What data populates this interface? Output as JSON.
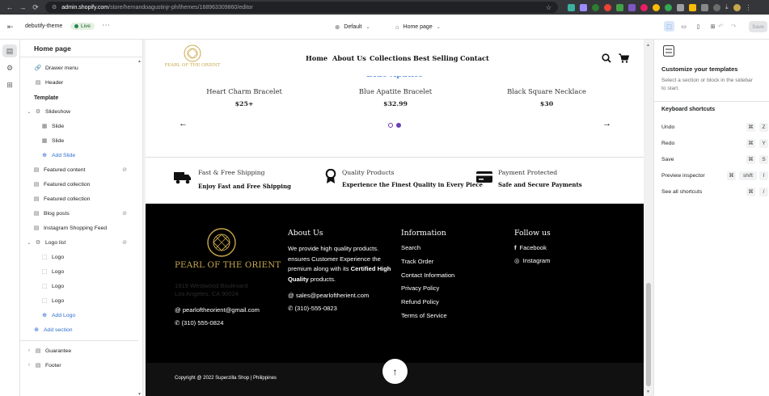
{
  "browser": {
    "url_host": "admin.shopify.com",
    "url_path": "/store/hernandoagustinjr-ph/themes/168963309860/editor"
  },
  "topbar": {
    "theme_name": "debutify-theme",
    "live_badge": "Live",
    "template_select": "Default",
    "page_select": "Home page",
    "save_label": "Save"
  },
  "sidebar": {
    "title": "Home page",
    "drawer_menu": "Drawer menu",
    "header": "Header",
    "template_heading": "Template",
    "slideshow": "Slideshow",
    "slide_1": "Slide",
    "slide_2": "Slide",
    "add_slide": "Add Slide",
    "featured_content": "Featured content",
    "featured_collection_1": "Featured collection",
    "featured_collection_2": "Featured collection",
    "blog_posts": "Blog posts",
    "instagram_feed": "Instagram Shopping Feed",
    "logo_list": "Logo list",
    "logo_1": "Logo",
    "logo_2": "Logo",
    "logo_3": "Logo",
    "logo_4": "Logo",
    "add_logo": "Add Logo",
    "add_section": "Add section",
    "guarantee": "Guarantee",
    "footer": "Footer"
  },
  "store": {
    "logo_text": "PEARL OF THE ORIENT",
    "nav": [
      "Home",
      "About Us",
      "Collections",
      "Best Selling",
      "Contact"
    ],
    "banner_overlay": "Blue Apatite",
    "products": [
      {
        "name": "Heart Charm Bracelet",
        "price": "$25+"
      },
      {
        "name": "Blue Apatite Bracelet",
        "price": "$32.99"
      },
      {
        "name": "Black Square Necklace",
        "price": "$30"
      }
    ],
    "features": [
      {
        "title": "Fast & Free Shipping",
        "sub": "Enjoy Fast and Free Shipping"
      },
      {
        "title": "Quality Products",
        "sub": "Experience the Finest Quality in Every Piece"
      },
      {
        "title": "Payment Protected",
        "sub": "Safe and Secure Payments"
      }
    ],
    "footer": {
      "logo_text": "PEARL OF THE ORIENT",
      "address_1": "1819 Westwood Boulevard",
      "address_2": "Los Angeles, CA 90024",
      "email": "pearloftheorient@gmail.com",
      "phone": "(310) 555-0824",
      "about_heading": "About Us",
      "about_text_1": "We provide high quality products. ensures Customer Experience the premium along with its ",
      "about_text_bold": "Certified High Quality",
      "about_text_2": " products.",
      "about_email": "sales@pearloftherient.com",
      "about_phone": "(310)-555-0823",
      "info_heading": "Information",
      "info_links": [
        "Search",
        "Track Order",
        "Contact Information",
        "Privacy Policy",
        "Refund Policy",
        "Terms of Service"
      ],
      "follow_heading": "Follow us",
      "facebook": "Facebook",
      "instagram": "Instagram",
      "copyright": "Copyright @ 2022 Superzilla Shop | Philippines"
    }
  },
  "rpanel": {
    "heading": "Customize your templates",
    "subtext": "Select a section or block in the sidebar to start.",
    "shortcuts_heading": "Keyboard shortcuts",
    "shortcuts": [
      {
        "label": "Undo",
        "mod": "⌘",
        "key": "Z"
      },
      {
        "label": "Redo",
        "mod": "⌘",
        "key": "Y"
      },
      {
        "label": "Save",
        "mod": "⌘",
        "key": "S"
      },
      {
        "label": "Preview inspector",
        "mod": "⌘",
        "mod2": "shift",
        "key": "I"
      },
      {
        "label": "See all shortcuts",
        "mod": "⌘",
        "key": "/"
      }
    ]
  },
  "colors": {
    "accent": "#2c6ecb",
    "gold": "#c9a84c",
    "footer_bg": "#000000",
    "live_green": "#29845a"
  }
}
